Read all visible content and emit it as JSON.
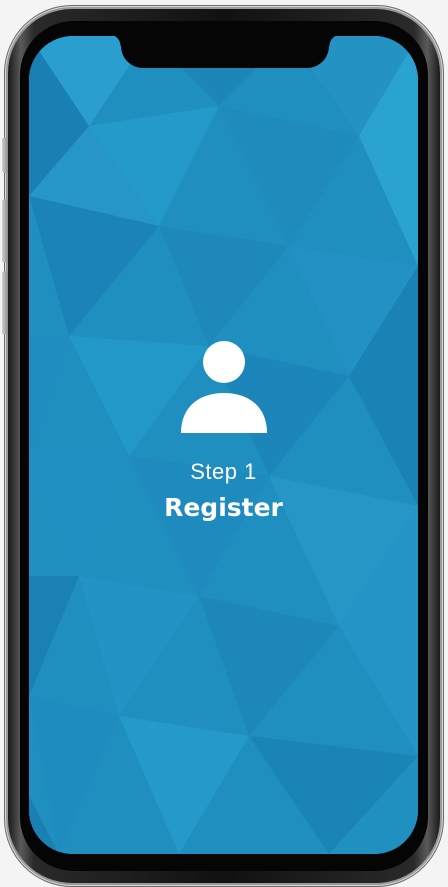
{
  "step": {
    "label": "Step 1",
    "title": "Register"
  },
  "icons": {
    "main": "user-icon"
  },
  "colors": {
    "background": "#1f8fbf",
    "text": "#ffffff",
    "frame": "#111111"
  }
}
